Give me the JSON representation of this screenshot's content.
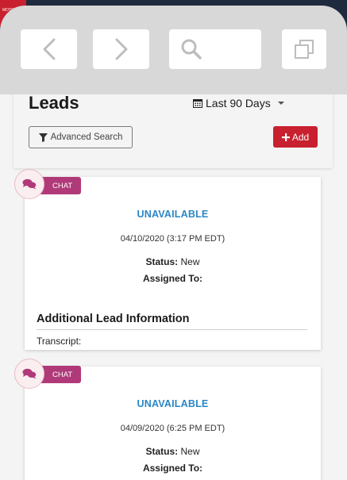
{
  "logo": {
    "text": "MOTOR"
  },
  "browser": {
    "back_icon": "chevron-left-icon",
    "forward_icon": "chevron-right-icon",
    "search_icon": "search-icon",
    "tabs_icon": "tabs-icon"
  },
  "header": {
    "title": "Leads",
    "date_filter": "Last 90 Days",
    "advanced_search": "Advanced Search",
    "add_label": "Add"
  },
  "leads": [
    {
      "channel": "CHAT",
      "status": "UNAVAILABLE",
      "date": "04/10/2020 (3:17 PM EDT)",
      "status_label": "Status:",
      "status_value": "New",
      "assigned_label": "Assigned To:",
      "assigned_value": "",
      "additional_title": "Additional Lead Information",
      "transcript_label": "Transcript:"
    },
    {
      "channel": "CHAT",
      "status": "UNAVAILABLE",
      "date": "04/09/2020 (6:25 PM EDT)",
      "status_label": "Status:",
      "status_value": "New",
      "assigned_label": "Assigned To:",
      "assigned_value": ""
    }
  ],
  "colors": {
    "accent_red": "#c8202e",
    "status_blue": "#2a86c5",
    "chat_tag": "#b03a79"
  }
}
